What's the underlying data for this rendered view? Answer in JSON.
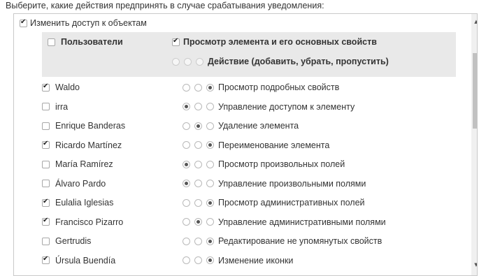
{
  "intro": "Выберите, какие действия предпринять в случае срабатывания уведомления:",
  "top_option": {
    "label": "Изменить доступ к объектам",
    "checked": true
  },
  "header": {
    "users_label": "Пользователи",
    "users_checked": false,
    "view_label": "Просмотр элемента и его основных свойств",
    "view_checked": true,
    "action_label": "Действие (добавить, убрать, пропустить)"
  },
  "rows": [
    {
      "user": "Waldo",
      "user_checked": true,
      "perm": "Просмотр подробных свойств",
      "choice": 3
    },
    {
      "user": "irra",
      "user_checked": false,
      "perm": "Управление доступом к элементу",
      "choice": 1
    },
    {
      "user": "Enrique Banderas",
      "user_checked": false,
      "perm": "Удаление элемента",
      "choice": 2
    },
    {
      "user": "Ricardo Martínez",
      "user_checked": true,
      "perm": "Переименование элемента",
      "choice": 3
    },
    {
      "user": "María Ramírez",
      "user_checked": false,
      "perm": "Просмотр произвольных полей",
      "choice": 1
    },
    {
      "user": "Álvaro Pardo",
      "user_checked": false,
      "perm": "Управление произвольными полями",
      "choice": 1
    },
    {
      "user": "Eulalia Iglesias",
      "user_checked": true,
      "perm": "Просмотр административных полей",
      "choice": 3
    },
    {
      "user": "Francisco Pizarro",
      "user_checked": true,
      "perm": "Управление административными полями",
      "choice": 2
    },
    {
      "user": "Gertrudis",
      "user_checked": false,
      "perm": "Редактирование не упомянутых свойств",
      "choice": 3
    },
    {
      "user": "Úrsula Buendía",
      "user_checked": true,
      "perm": "Изменение иконки",
      "choice": 3
    }
  ],
  "icons": {
    "scroll_up": "triangle-up",
    "scroll_down": "triangle-down"
  }
}
